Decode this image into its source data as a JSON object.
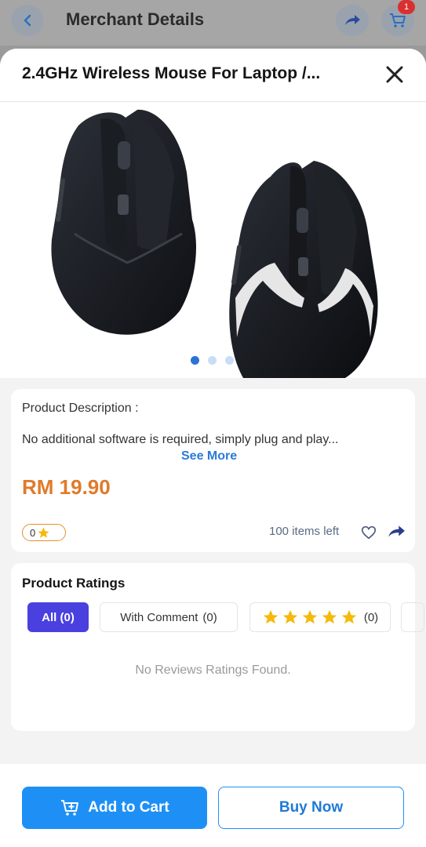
{
  "background_header": {
    "title": "Merchant Details",
    "cart_badge_count": "1"
  },
  "sheet": {
    "title": "2.4GHz Wireless Mouse For Laptop /...",
    "gallery": {
      "slide_count": 3,
      "active_slide": 1
    }
  },
  "description": {
    "heading": "Product Description :",
    "text": "No additional software is required, simply plug and play...",
    "see_more_label": "See More",
    "price": "RM 19.90",
    "rating_value": "0",
    "items_left": "100 items left"
  },
  "ratings": {
    "heading": "Product Ratings",
    "filters": {
      "all_label": "All",
      "all_count": "(0)",
      "comment_label": "With Comment",
      "comment_count": "(0)",
      "stars_count": "(0)"
    },
    "stars": 5,
    "empty_message": "No Reviews Ratings Found."
  },
  "actions": {
    "add_to_cart_label": "Add to Cart",
    "buy_now_label": "Buy Now"
  },
  "colors": {
    "primary": "#1e90f5",
    "price": "#e07a2a",
    "filter_active": "#4a40e0",
    "star": "#f5b90a"
  }
}
